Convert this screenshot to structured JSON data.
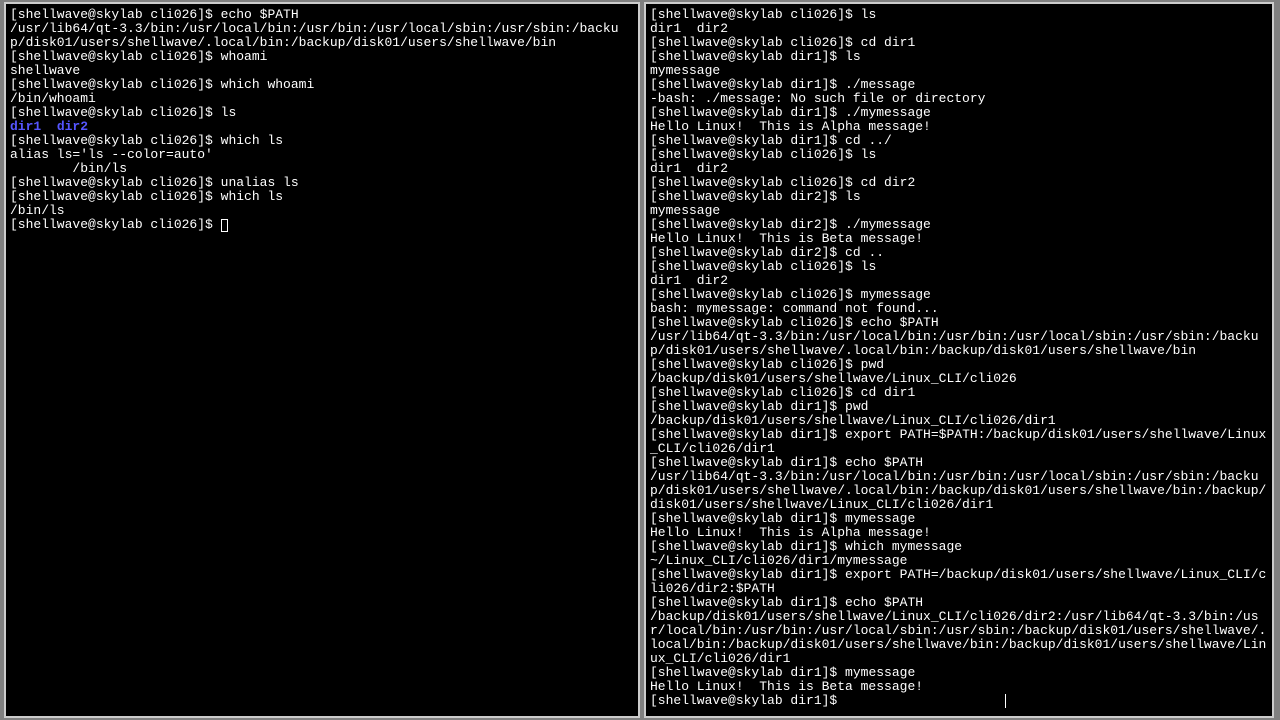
{
  "left": {
    "lines": [
      {
        "t": "prompt",
        "prompt": "[shellwave@skylab cli026]$ ",
        "cmd": "echo $PATH"
      },
      {
        "t": "out",
        "text": "/usr/lib64/qt-3.3/bin:/usr/local/bin:/usr/bin:/usr/local/sbin:/usr/sbin:/backup/disk01/users/shellwave/.local/bin:/backup/disk01/users/shellwave/bin"
      },
      {
        "t": "prompt",
        "prompt": "[shellwave@skylab cli026]$ ",
        "cmd": "whoami"
      },
      {
        "t": "out",
        "text": "shellwave"
      },
      {
        "t": "prompt",
        "prompt": "[shellwave@skylab cli026]$ ",
        "cmd": "which whoami"
      },
      {
        "t": "out",
        "text": "/bin/whoami"
      },
      {
        "t": "prompt",
        "prompt": "[shellwave@skylab cli026]$ ",
        "cmd": "ls"
      },
      {
        "t": "dirs",
        "items": [
          "dir1",
          "dir2"
        ]
      },
      {
        "t": "prompt",
        "prompt": "[shellwave@skylab cli026]$ ",
        "cmd": "which ls"
      },
      {
        "t": "out",
        "text": "alias ls='ls --color=auto'"
      },
      {
        "t": "out",
        "text": "        /bin/ls"
      },
      {
        "t": "prompt",
        "prompt": "[shellwave@skylab cli026]$ ",
        "cmd": "unalias ls"
      },
      {
        "t": "prompt",
        "prompt": "[shellwave@skylab cli026]$ ",
        "cmd": "which ls"
      },
      {
        "t": "out",
        "text": "/bin/ls"
      },
      {
        "t": "prompt_cursor",
        "prompt": "[shellwave@skylab cli026]$ "
      }
    ]
  },
  "right": {
    "lines": [
      {
        "t": "prompt",
        "prompt": "[shellwave@skylab cli026]$ ",
        "cmd": "ls"
      },
      {
        "t": "out",
        "text": "dir1  dir2"
      },
      {
        "t": "prompt",
        "prompt": "[shellwave@skylab cli026]$ ",
        "cmd": "cd dir1"
      },
      {
        "t": "prompt",
        "prompt": "[shellwave@skylab dir1]$ ",
        "cmd": "ls"
      },
      {
        "t": "out",
        "text": "mymessage"
      },
      {
        "t": "prompt",
        "prompt": "[shellwave@skylab dir1]$ ",
        "cmd": "./message"
      },
      {
        "t": "out",
        "text": "-bash: ./message: No such file or directory"
      },
      {
        "t": "prompt",
        "prompt": "[shellwave@skylab dir1]$ ",
        "cmd": "./mymessage"
      },
      {
        "t": "out",
        "text": "Hello Linux!  This is Alpha message!"
      },
      {
        "t": "prompt",
        "prompt": "[shellwave@skylab dir1]$ ",
        "cmd": "cd ../"
      },
      {
        "t": "prompt",
        "prompt": "[shellwave@skylab cli026]$ ",
        "cmd": "ls"
      },
      {
        "t": "out",
        "text": "dir1  dir2"
      },
      {
        "t": "prompt",
        "prompt": "[shellwave@skylab cli026]$ ",
        "cmd": "cd dir2"
      },
      {
        "t": "prompt",
        "prompt": "[shellwave@skylab dir2]$ ",
        "cmd": "ls"
      },
      {
        "t": "out",
        "text": "mymessage"
      },
      {
        "t": "prompt",
        "prompt": "[shellwave@skylab dir2]$ ",
        "cmd": "./mymessage"
      },
      {
        "t": "out",
        "text": "Hello Linux!  This is Beta message!"
      },
      {
        "t": "prompt",
        "prompt": "[shellwave@skylab dir2]$ ",
        "cmd": "cd .."
      },
      {
        "t": "prompt",
        "prompt": "[shellwave@skylab cli026]$ ",
        "cmd": "ls"
      },
      {
        "t": "out",
        "text": "dir1  dir2"
      },
      {
        "t": "prompt",
        "prompt": "[shellwave@skylab cli026]$ ",
        "cmd": "mymessage"
      },
      {
        "t": "out",
        "text": "bash: mymessage: command not found..."
      },
      {
        "t": "prompt",
        "prompt": "[shellwave@skylab cli026]$ ",
        "cmd": "echo $PATH"
      },
      {
        "t": "out",
        "text": "/usr/lib64/qt-3.3/bin:/usr/local/bin:/usr/bin:/usr/local/sbin:/usr/sbin:/backup/disk01/users/shellwave/.local/bin:/backup/disk01/users/shellwave/bin"
      },
      {
        "t": "prompt",
        "prompt": "[shellwave@skylab cli026]$ ",
        "cmd": "pwd"
      },
      {
        "t": "out",
        "text": "/backup/disk01/users/shellwave/Linux_CLI/cli026"
      },
      {
        "t": "prompt",
        "prompt": "[shellwave@skylab cli026]$ ",
        "cmd": "cd dir1"
      },
      {
        "t": "prompt",
        "prompt": "[shellwave@skylab dir1]$ ",
        "cmd": "pwd"
      },
      {
        "t": "out",
        "text": "/backup/disk01/users/shellwave/Linux_CLI/cli026/dir1"
      },
      {
        "t": "prompt",
        "prompt": "[shellwave@skylab dir1]$ ",
        "cmd": "export PATH=$PATH:/backup/disk01/users/shellwave/Linux_CLI/cli026/dir1"
      },
      {
        "t": "prompt",
        "prompt": "[shellwave@skylab dir1]$ ",
        "cmd": "echo $PATH"
      },
      {
        "t": "out",
        "text": "/usr/lib64/qt-3.3/bin:/usr/local/bin:/usr/bin:/usr/local/sbin:/usr/sbin:/backup/disk01/users/shellwave/.local/bin:/backup/disk01/users/shellwave/bin:/backup/disk01/users/shellwave/Linux_CLI/cli026/dir1"
      },
      {
        "t": "prompt",
        "prompt": "[shellwave@skylab dir1]$ ",
        "cmd": "mymessage"
      },
      {
        "t": "out",
        "text": "Hello Linux!  This is Alpha message!"
      },
      {
        "t": "prompt",
        "prompt": "[shellwave@skylab dir1]$ ",
        "cmd": "which mymessage"
      },
      {
        "t": "out",
        "text": "~/Linux_CLI/cli026/dir1/mymessage"
      },
      {
        "t": "prompt",
        "prompt": "[shellwave@skylab dir1]$ ",
        "cmd": "export PATH=/backup/disk01/users/shellwave/Linux_CLI/cli026/dir2:$PATH"
      },
      {
        "t": "prompt",
        "prompt": "[shellwave@skylab dir1]$ ",
        "cmd": "echo $PATH"
      },
      {
        "t": "out",
        "text": "/backup/disk01/users/shellwave/Linux_CLI/cli026/dir2:/usr/lib64/qt-3.3/bin:/usr/local/bin:/usr/bin:/usr/local/sbin:/usr/sbin:/backup/disk01/users/shellwave/.local/bin:/backup/disk01/users/shellwave/bin:/backup/disk01/users/shellwave/Linux_CLI/cli026/dir1"
      },
      {
        "t": "prompt",
        "prompt": "[shellwave@skylab dir1]$ ",
        "cmd": "mymessage"
      },
      {
        "t": "out",
        "text": "Hello Linux!  This is Beta message!"
      },
      {
        "t": "prompt_ibeam",
        "prompt": "[shellwave@skylab dir1]$ "
      }
    ]
  }
}
